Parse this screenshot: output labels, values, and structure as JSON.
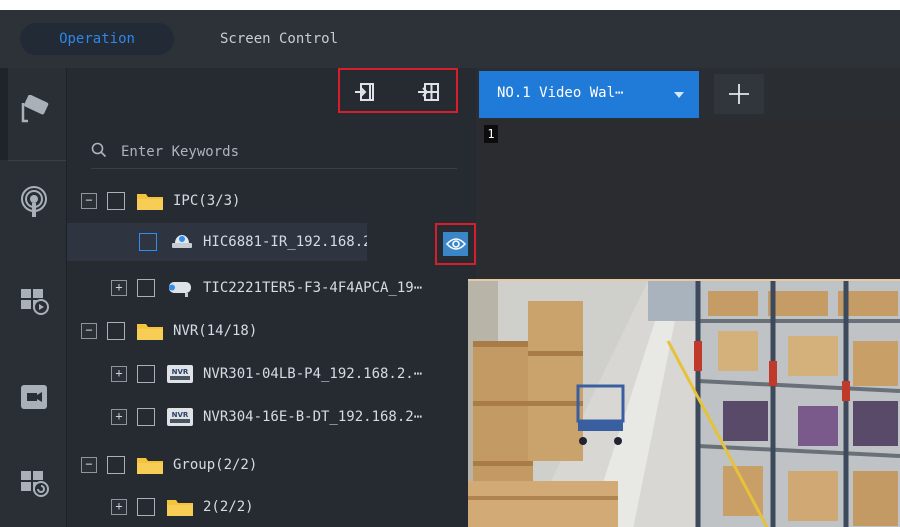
{
  "top_tabs": {
    "operation": "Operation",
    "screen_control": "Screen Control"
  },
  "colors": {
    "accent": "#1f7ad8",
    "highlight_box": "#d81e2c",
    "folder": "#f5c23c"
  },
  "rail": {
    "icons": [
      "camera-icon",
      "alarm-signal-icon",
      "wall-playback-icon",
      "video-icon",
      "wall-replay-icon"
    ]
  },
  "toolbar": {
    "icons": [
      "import-to-window-icon",
      "import-to-wall-icon"
    ]
  },
  "search": {
    "placeholder": "Enter Keywords"
  },
  "tree": {
    "ipc_group": "IPC(3/3)",
    "ipc_device_1": "HIC6881-IR_192.168.2.⋯",
    "ipc_device_2": "TIC2221TER5-F3-4F4APCA_19⋯",
    "nvr_group": "NVR(14/18)",
    "nvr_device_1": "NVR301-04LB-P4_192.168.2.⋯",
    "nvr_device_2": "NVR304-16E-B-DT_192.168.2⋯",
    "custom_group": "Group(2/2)",
    "sub_group": "2(2/2)",
    "nvr_badge": "NVR"
  },
  "video_wall": {
    "tab_label": "NO.1 Video Wal⋯",
    "add_label": "+",
    "screen_number": "1"
  }
}
